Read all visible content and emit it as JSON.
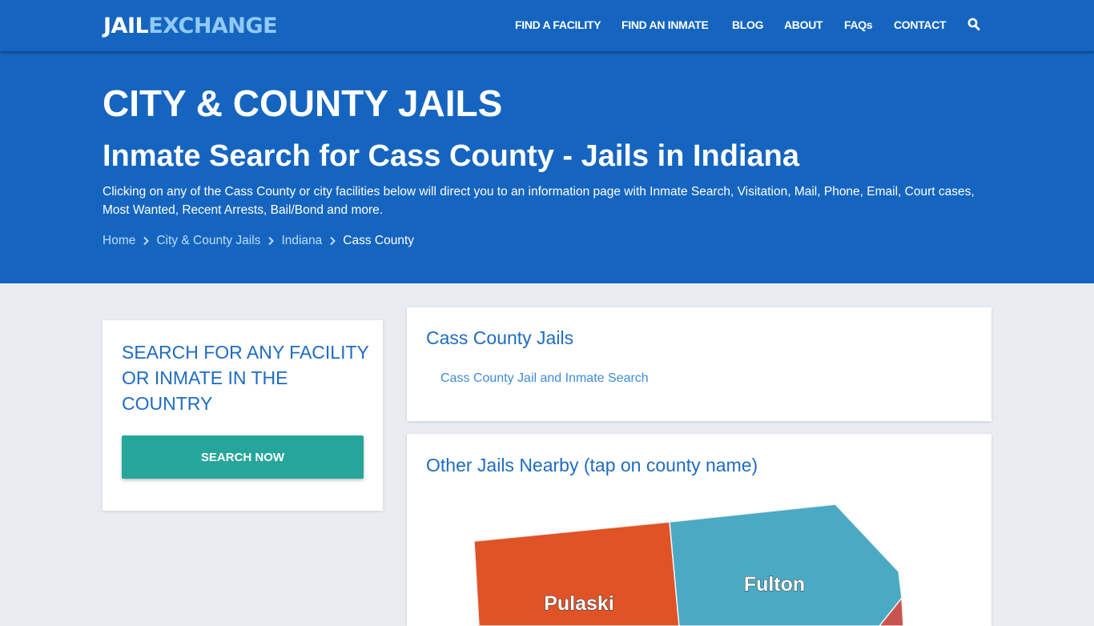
{
  "header": {
    "logo": {
      "part1": "JAIL",
      "part2": "EXCHANGE"
    },
    "nav": [
      {
        "label": "FIND A FACILITY"
      },
      {
        "label": "FIND AN INMATE"
      },
      {
        "label": "BLOG"
      },
      {
        "label": "ABOUT"
      },
      {
        "label": "FAQs"
      },
      {
        "label": "CONTACT"
      }
    ],
    "search_icon": "search-icon"
  },
  "hero": {
    "title": "CITY & COUNTY JAILS",
    "subtitle": "Inmate Search for Cass County - Jails in Indiana",
    "description": "Clicking on any of the Cass County or city facilities below will direct you to an information page with Inmate Search, Visitation, Mail, Phone, Email, Court cases, Most Wanted, Recent Arrests, Bail/Bond and more.",
    "breadcrumb": [
      {
        "label": "Home"
      },
      {
        "label": "City & County Jails"
      },
      {
        "label": "Indiana"
      },
      {
        "label": "Cass County"
      }
    ]
  },
  "search_card": {
    "heading": "SEARCH FOR ANY FACILITY OR INMATE IN THE COUNTRY",
    "button_label": "SEARCH NOW"
  },
  "jails_card": {
    "heading": "Cass County Jails",
    "links": [
      {
        "label": "Cass County Jail and Inmate Search"
      }
    ]
  },
  "nearby_card": {
    "heading": "Other Jails Nearby (tap on county name)",
    "counties": [
      {
        "name": "Pulaski",
        "color": "#e05326"
      },
      {
        "name": "Fulton",
        "color": "#4aaac4"
      },
      {
        "name": "",
        "color": "#c9534f"
      }
    ]
  },
  "colors": {
    "brand_blue": "#1565c0",
    "logo_accent": "#90caf9",
    "heading_blue": "#1e6bc4",
    "button_teal": "#26a69a",
    "page_bg": "#e9edf1"
  }
}
